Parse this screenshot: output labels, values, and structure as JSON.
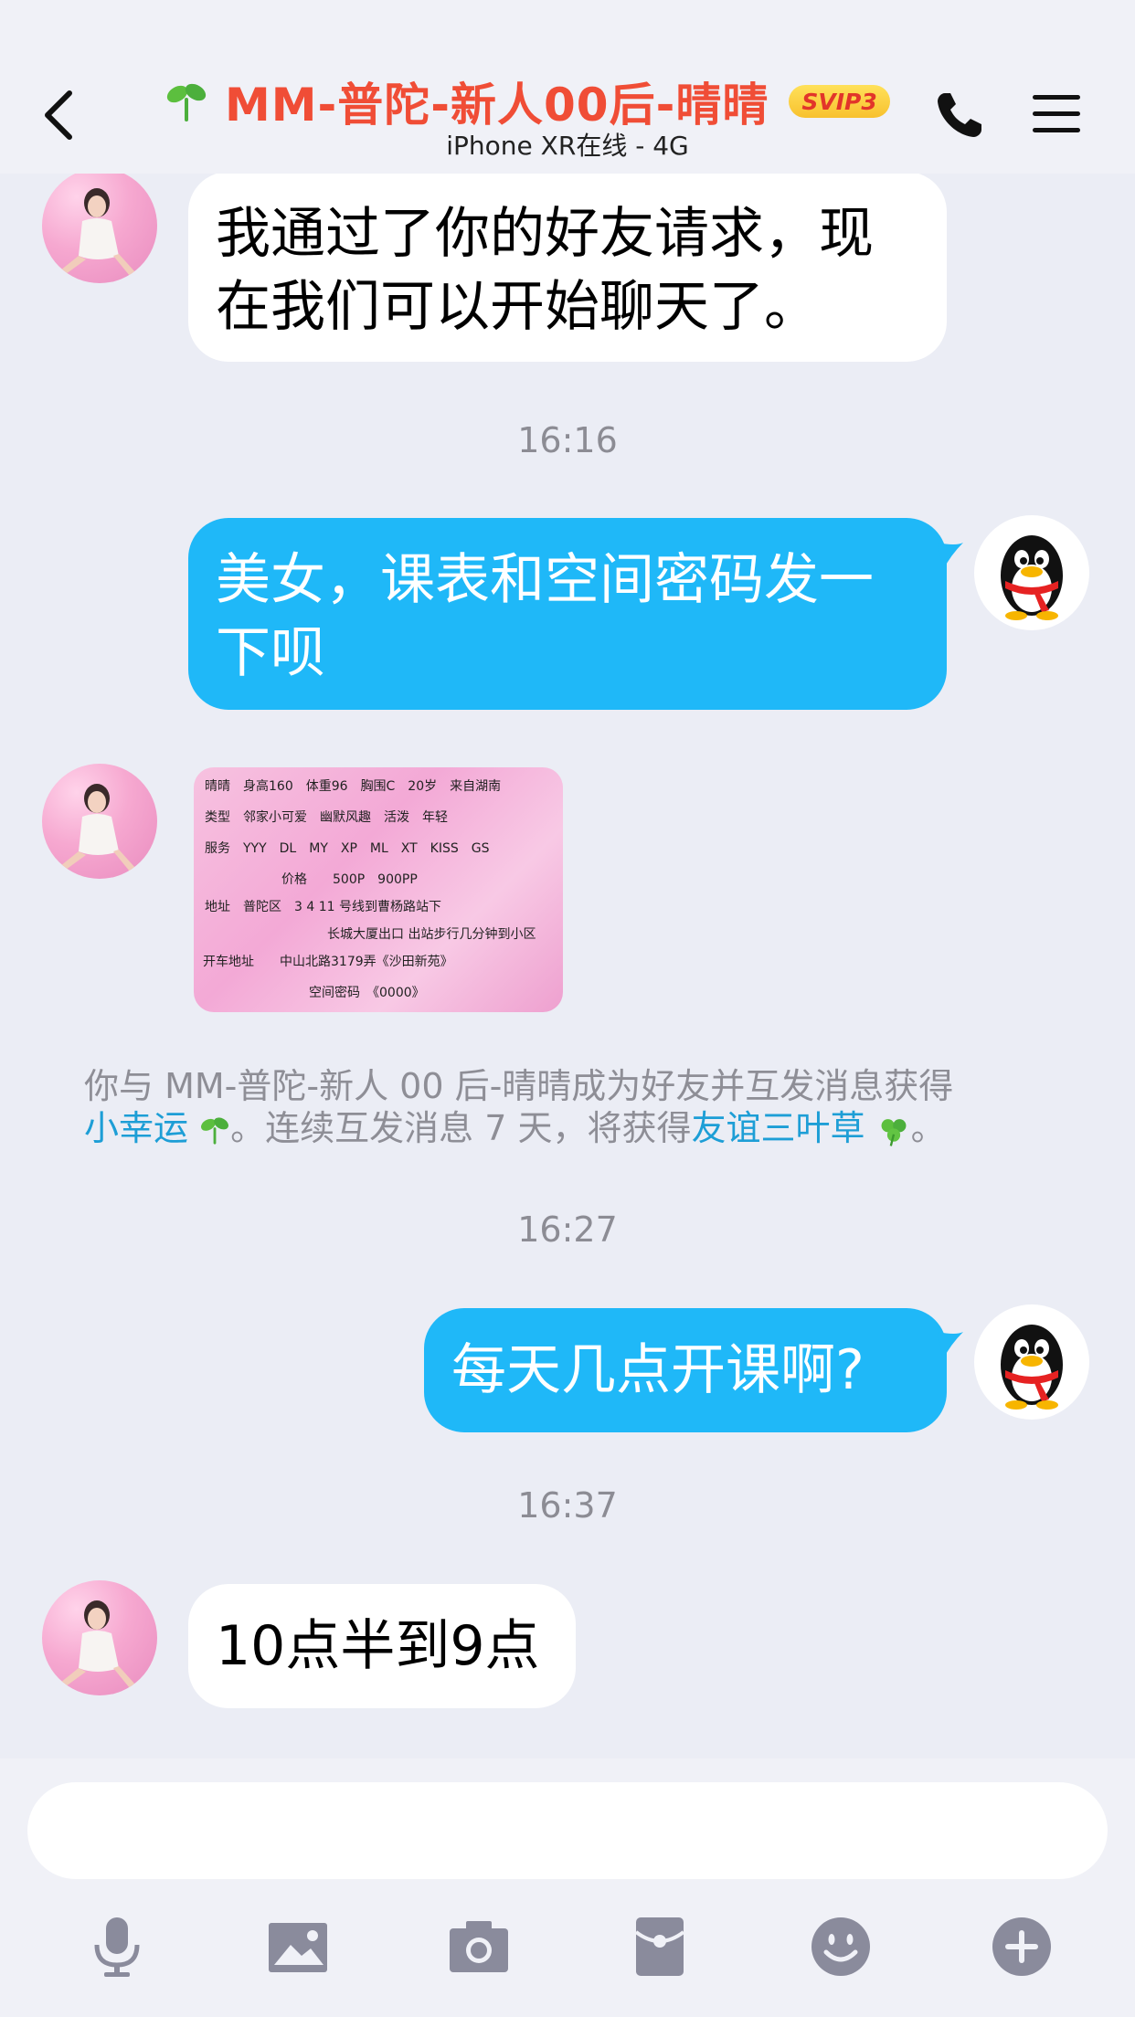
{
  "header": {
    "back_icon": "chevron-left-icon",
    "title": "MM-普陀-新人00后-晴晴",
    "badge": "SVIP3",
    "subtitle": "iPhone XR在线 - 4G",
    "title_color": "#f04d36"
  },
  "messages": [
    {
      "type": "incoming",
      "text_line1": "我通过了你的好友请求，现",
      "text_line2": "在我们可以开始聊天了。"
    },
    {
      "type": "time",
      "text": "16:16"
    },
    {
      "type": "outgoing",
      "text_line1": "美女，课表和空间密码发一",
      "text_line2": "下呗"
    },
    {
      "type": "image",
      "lines": [
        "晴晴　身高160　体重96　胸围C　20岁　来自湖南",
        "类型　邻家小可爱　幽默风趣　活泼　年轻",
        "服务　YYY　DL　MY　XP　ML　XT　KISS　GS",
        "价格　　500P　900PP",
        "地址　普陀区　3  4  11 号线到曹杨路站下",
        "长城大厦出口  出站步行几分钟到小区",
        "开车地址　　中山北路3179弄《沙田新苑》",
        "空间密码　《0000》"
      ]
    },
    {
      "type": "system",
      "part1": "你与 MM-普陀-新人 00 后-晴晴成为好友并互发消息获得",
      "link1": "小幸运",
      "part2": "。连续互发消息 7 天，将获得",
      "link2": "友谊三叶草",
      "part3": "。"
    },
    {
      "type": "time",
      "text": "16:27"
    },
    {
      "type": "outgoing",
      "text": "每天几点开课啊?"
    },
    {
      "type": "time",
      "text": "16:37"
    },
    {
      "type": "incoming",
      "text": "10点半到9点"
    }
  ],
  "input": {
    "placeholder": ""
  },
  "toolbar": [
    "microphone-icon",
    "image-icon",
    "camera-icon",
    "red-packet-icon",
    "emoji-icon",
    "plus-icon"
  ],
  "colors": {
    "outgoing_bubble": "#1fb8f8",
    "incoming_bubble": "#ffffff",
    "background": "#ebedf5",
    "link": "#1d9ed6"
  }
}
